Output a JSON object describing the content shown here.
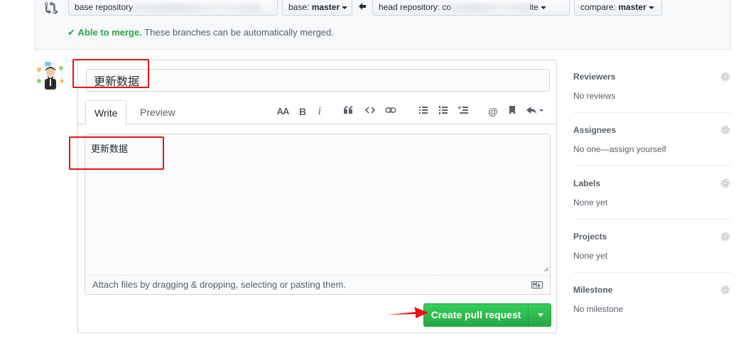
{
  "compare": {
    "base_repo_label": "base repository",
    "base_label": "base:",
    "base_value": "master",
    "head_repo_label": "head repository: co",
    "head_repo_suffix": "ite",
    "compare_label": "compare:",
    "compare_value": "master",
    "merge_status": "Able to merge.",
    "merge_message": "These branches can be automatically merged."
  },
  "form": {
    "title_value": "更新数据",
    "tabs": [
      {
        "label": "Write"
      },
      {
        "label": "Preview"
      }
    ],
    "body_value": "更新数据",
    "attach_text": "Attach files by dragging & dropping, selecting or pasting them.",
    "submit_label": "Create pull request"
  },
  "toolbar": {
    "icons": [
      "text-size-icon",
      "bold-icon",
      "italic-icon",
      "quote-icon",
      "code-icon",
      "link-icon",
      "bulleted-list-icon",
      "numbered-list-icon",
      "task-list-icon",
      "mention-icon",
      "bookmark-icon",
      "reply-icon"
    ],
    "text_size": "AA",
    "bold": "B",
    "italic": "i",
    "mention": "@"
  },
  "sidebar": {
    "sections": [
      {
        "heading": "Reviewers",
        "value": "No reviews"
      },
      {
        "heading": "Assignees",
        "value": "No one—assign yourself"
      },
      {
        "heading": "Labels",
        "value": "None yet"
      },
      {
        "heading": "Projects",
        "value": "None yet"
      },
      {
        "heading": "Milestone",
        "value": "No milestone"
      }
    ]
  },
  "colors": {
    "accent_green": "#28a745",
    "annotation_red": "#e11111",
    "border": "#d1d5da"
  }
}
